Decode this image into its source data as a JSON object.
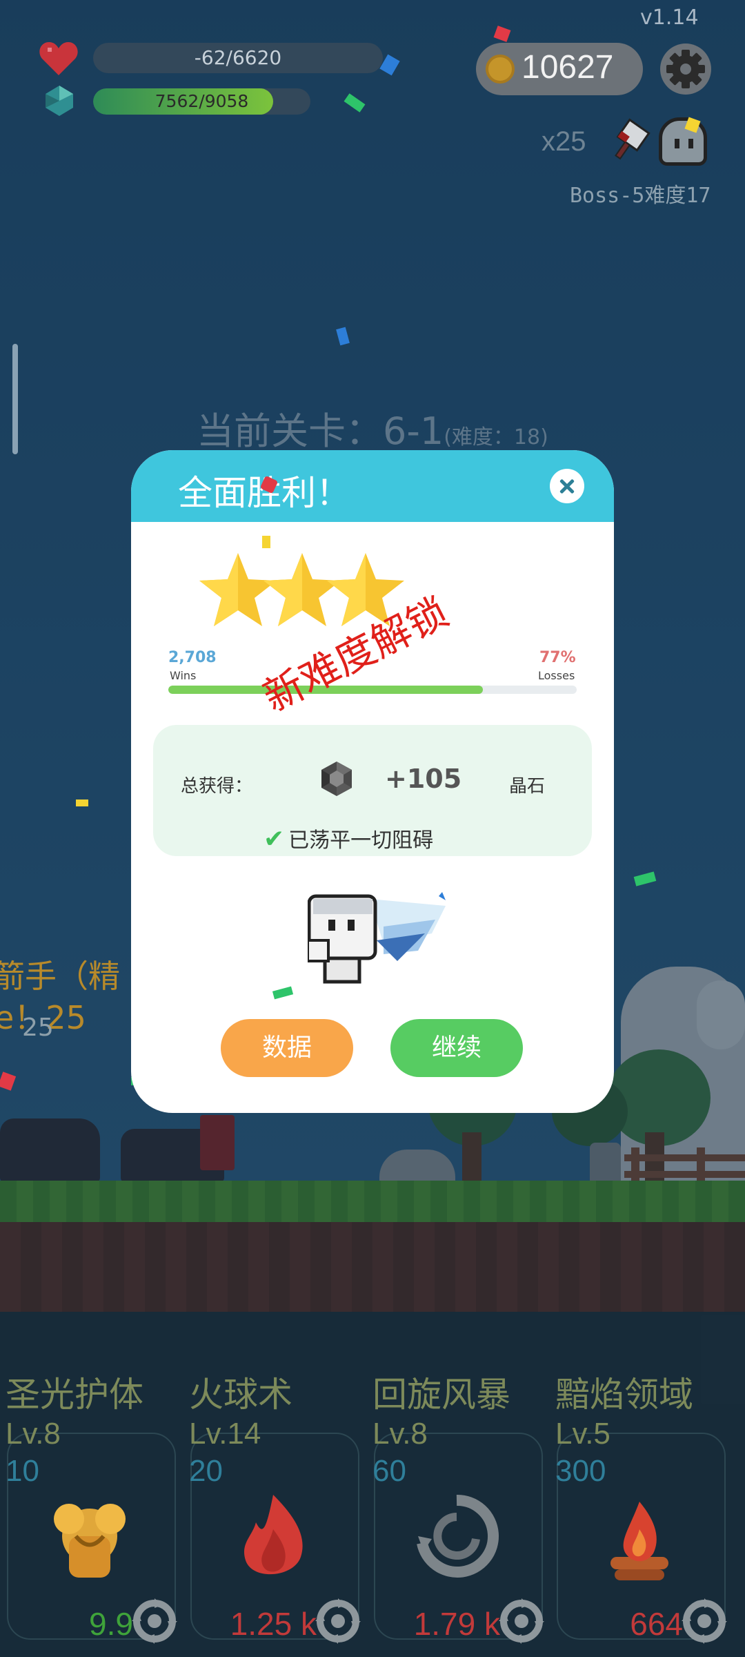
{
  "hud": {
    "version": "v1.14",
    "hp_text": "-62/6620",
    "xp_text": "7562/9058",
    "xp_fraction": 0.83,
    "coins": "10627",
    "multiplier": "x25",
    "boss_label": "Boss-5难度17",
    "level_title": "当前关卡：6-1",
    "level_difficulty": "(难度：18)"
  },
  "side_text": {
    "line1": "箭手（精",
    "line2": "e！25",
    "line3": "25"
  },
  "dialog": {
    "title": "全面胜利！",
    "stars": 3,
    "wins_value": "2,708",
    "wins_label": "Wins",
    "losses_value": "77%",
    "losses_label": "Losses",
    "win_fraction": 0.77,
    "stamp": "新难度解锁",
    "reward_label": "总获得：",
    "reward_value": "+105",
    "reward_unit": "晶石",
    "cleared_text": "已荡平一切阻碍",
    "btn_data": "数据",
    "btn_continue": "继续"
  },
  "skills": [
    {
      "name": "圣光护体",
      "level": "Lv.8",
      "cost": "10",
      "value": "9.9",
      "value_color": "#3fa33a",
      "icon": "holy-shield-icon"
    },
    {
      "name": "火球术",
      "level": "Lv.14",
      "cost": "20",
      "value": "1.25 k",
      "value_color": "#c23a3a",
      "icon": "fireball-icon"
    },
    {
      "name": "回旋风暴",
      "level": "Lv.8",
      "cost": "60",
      "value": "1.79 k",
      "value_color": "#c23a3a",
      "icon": "whirlwind-icon"
    },
    {
      "name": "黯焰领域",
      "level": "Lv.5",
      "cost": "300",
      "value": "664",
      "value_color": "#c23a3a",
      "icon": "campfire-icon"
    }
  ],
  "colors": {
    "dialog_header": "#3fc6dd",
    "btn_data": "#f9a64a",
    "btn_continue": "#57cc62",
    "stamp": "#e0201a"
  }
}
